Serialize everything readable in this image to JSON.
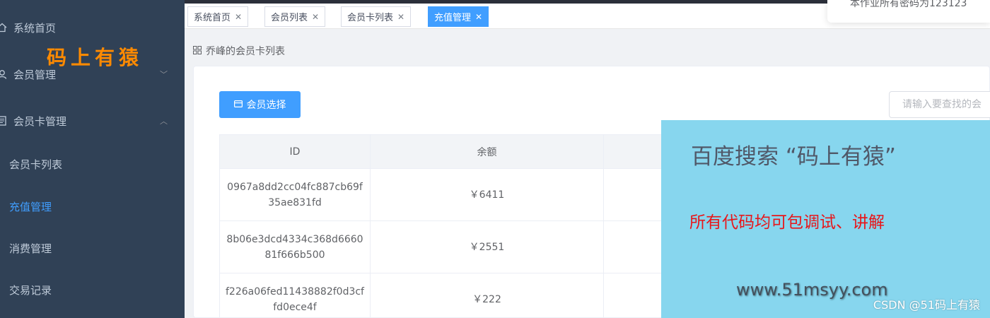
{
  "sidebar": {
    "items": [
      {
        "label": "系统首页",
        "icon": "home-icon"
      },
      {
        "label": "会员管理",
        "icon": "user-icon",
        "arrow": "﹀"
      },
      {
        "label": "会员卡管理",
        "icon": "document-icon",
        "arrow": "︿"
      }
    ],
    "sub_items": [
      {
        "label": "会员卡列表"
      },
      {
        "label": "充值管理"
      },
      {
        "label": "消费管理"
      },
      {
        "label": "交易记录"
      }
    ],
    "brand": "码上有猿"
  },
  "tags": [
    {
      "label": "系统首页"
    },
    {
      "label": "会员列表"
    },
    {
      "label": "会员卡列表"
    },
    {
      "label": "充值管理"
    }
  ],
  "notice": "本作业所有密码为123123",
  "breadcrumb": "乔峰的会员卡列表",
  "toolbar": {
    "select_label": "会员选择",
    "search_placeholder": "请输入要查找的会"
  },
  "table": {
    "headers": [
      "ID",
      "余额",
      ""
    ],
    "rows": [
      {
        "id": "0967a8dd2cc04fc887cb69f35ae831fd",
        "balance": "￥6411"
      },
      {
        "id": "8b06e3dcd4334c368d666081f666b500",
        "balance": "￥2551"
      },
      {
        "id": "f226a06fed11438882f0d3cffd0ece4f",
        "balance": "￥222"
      }
    ]
  },
  "ad": {
    "title": "百度搜索 “码上有猿”",
    "subtitle": "所有代码均可包调试、讲解",
    "url": "www.51msyy.com"
  },
  "watermark": "CSDN @51码上有猿",
  "colors": {
    "sidebar_bg": "#304156",
    "accent": "#409eff",
    "brand": "#ff8a00",
    "ad_bg": "#87d6ee",
    "ad_red": "#e8161a"
  }
}
